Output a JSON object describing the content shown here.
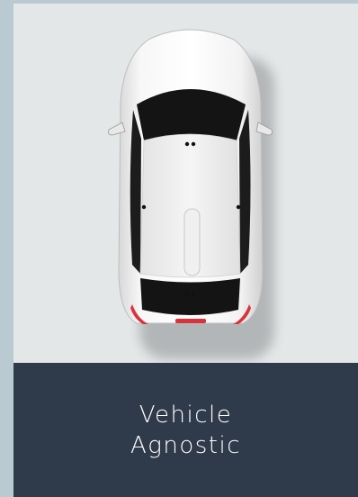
{
  "card": {
    "caption_line1": "Vehicle",
    "caption_line2": "Agnostic",
    "image_alt": "car-top-view"
  },
  "colors": {
    "page_bg": "#b9cad3",
    "image_bg": "#e4e7e8",
    "caption_bg": "#2f3a4a",
    "caption_text": "#ffffff",
    "car_body": "#f4f4f4",
    "car_glass": "#1a1a1a",
    "taillight": "#d9323a"
  }
}
